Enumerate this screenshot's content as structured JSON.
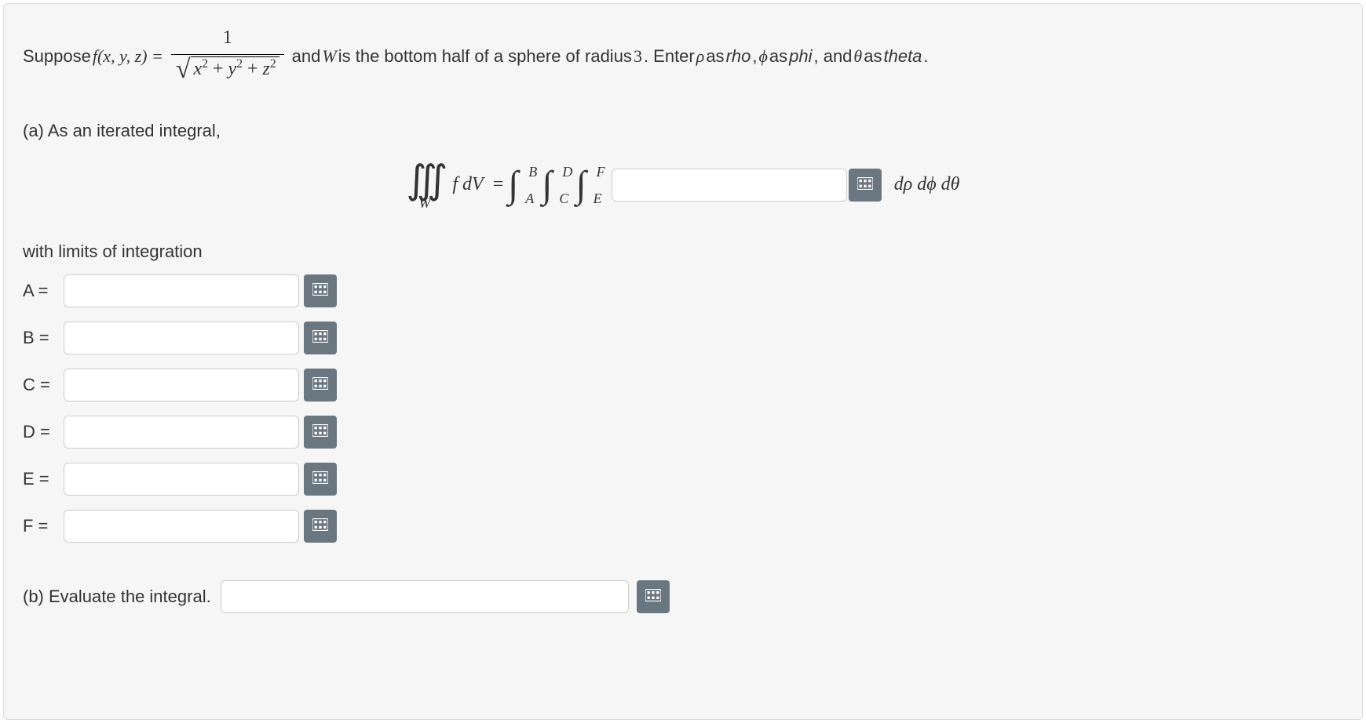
{
  "prompt": {
    "lead": "Suppose ",
    "f_lhs": "f(x, y, z) = ",
    "frac_num": "1",
    "sqrt_expr_parts": {
      "x": "x",
      "y": "y",
      "z": "z",
      "plus": " + ",
      "sq": "2"
    },
    "mid": " and ",
    "W": "W",
    "after_w": " is the bottom half of a sphere of radius ",
    "radius": "3",
    "enter": ". Enter ",
    "rho_sym": "ρ",
    "as1": " as ",
    "rho_txt": "rho",
    "comma1": ", ",
    "phi_sym": "ϕ",
    "phi_txt": "phi",
    "comma2": ", and ",
    "theta_sym": "θ",
    "theta_txt": "theta",
    "period": "."
  },
  "part_a": {
    "label": "(a) As an iterated integral,",
    "triple_sub": "W",
    "f_dv": "f dV",
    "equals": " = ",
    "bounds": {
      "outer_lo": "A",
      "outer_hi": "B",
      "mid_lo": "C",
      "mid_hi": "D",
      "inner_lo": "E",
      "inner_hi": "F"
    },
    "integrand_value": "",
    "differentials": "dρ dϕ dθ",
    "limits_caption": "with limits of integration",
    "limits": [
      {
        "label": "A =",
        "value": ""
      },
      {
        "label": "B =",
        "value": ""
      },
      {
        "label": "C =",
        "value": ""
      },
      {
        "label": "D =",
        "value": ""
      },
      {
        "label": "E =",
        "value": ""
      },
      {
        "label": "F =",
        "value": ""
      }
    ]
  },
  "part_b": {
    "label": "(b) Evaluate the integral.",
    "value": ""
  },
  "icons": {
    "keypad": "keypad-icon"
  }
}
